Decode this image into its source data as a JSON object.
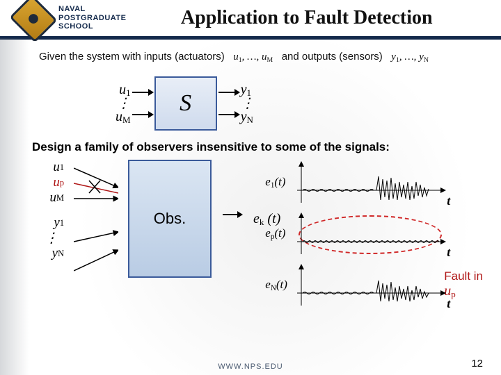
{
  "header": {
    "institution_line1": "NAVAL",
    "institution_line2": "POSTGRADUATE",
    "institution_line3": "SCHOOL",
    "title": "Application to Fault Detection"
  },
  "intro": {
    "given_prefix": "Given the system with inputs (actuators)",
    "inputs_expr": "u₁, …, u_M",
    "and_outputs": "and outputs (sensors)",
    "outputs_expr": "y₁, …, y_N"
  },
  "system_block": {
    "in_top": "u₁",
    "in_bot": "u_M",
    "label": "S",
    "out_top": "y₁",
    "out_bot": "y_N"
  },
  "statement": "Design a family of observers insensitive to some of the signals:",
  "observer": {
    "inputs": {
      "u1": "u₁",
      "up": "u_p",
      "uM": "u_M",
      "y1": "y₁",
      "yN": "y_N"
    },
    "label": "Obs.",
    "output": "e_k (t)"
  },
  "plots": {
    "e1": "e₁(t)",
    "ep": "e_p(t)",
    "eN": "e_N(t)",
    "axis": "t"
  },
  "fault": {
    "text": "Fault in",
    "var": "u_p"
  },
  "footer_url": "WWW.NPS.EDU",
  "page": "12"
}
